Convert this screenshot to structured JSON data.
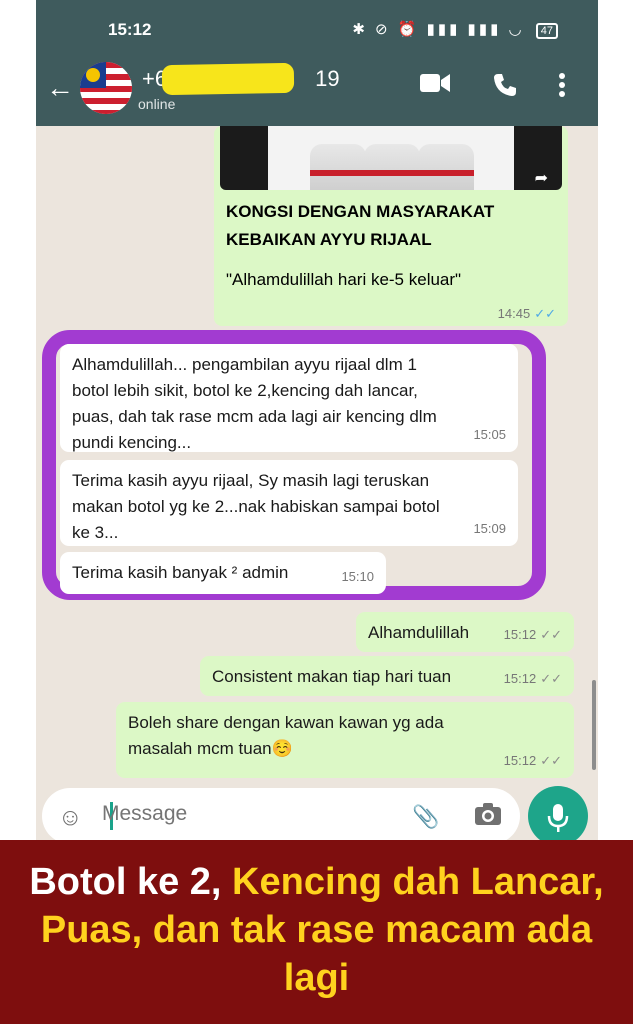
{
  "status": {
    "time": "15:12",
    "icons": "✱ ⊘ ⏰ ▮▮▮ ▮▮▮ ◡",
    "battery": "47"
  },
  "header": {
    "back_icon": "arrow-left-icon",
    "contact_prefix": "+6",
    "contact_suffix": "19",
    "status": "online",
    "video_icon": "video-icon",
    "call_icon": "phone-icon",
    "menu_icon": "more-icon"
  },
  "forwarded": {
    "heading_line1": "KONGSI DENGAN MASYARAKAT",
    "heading_line2": "KEBAIKAN AYYU RIJAAL",
    "quote": "\"Alhamdulillah hari ke-5 keluar\"",
    "time": "14:45"
  },
  "messages": [
    {
      "dir": "in",
      "lines": [
        "Alhamdulillah... pengambilan ayyu rijaal dlm 1",
        "botol lebih sikit, botol ke 2,kencing dah lancar,",
        "puas, dah tak rase mcm ada lagi air kencing dlm",
        "pundi kencing..."
      ],
      "time": "15:05"
    },
    {
      "dir": "in",
      "lines": [
        "Terima kasih ayyu rijaal, Sy masih lagi teruskan",
        "makan botol yg ke 2...nak habiskan sampai botol",
        "ke 3..."
      ],
      "time": "15:09"
    },
    {
      "dir": "in",
      "lines": [
        "Terima kasih banyak ² admin"
      ],
      "time": "15:10"
    },
    {
      "dir": "out",
      "lines": [
        "Alhamdulillah"
      ],
      "time": "15:12"
    },
    {
      "dir": "out",
      "lines": [
        "Consistent makan tiap hari tuan"
      ],
      "time": "15:12"
    },
    {
      "dir": "out",
      "lines": [
        "Boleh share dengan kawan kawan yg ada",
        "masalah mcm tuan☺️"
      ],
      "time": "15:12"
    }
  ],
  "input": {
    "placeholder": "Message",
    "emoji_icon": "emoji-icon",
    "attach_icon": "paperclip-icon",
    "camera_icon": "camera-icon",
    "mic_icon": "mic-icon"
  },
  "banner": {
    "line1_white": "Botol ke 2,",
    "line1_yellow": "Kencing dah Lancar,",
    "line2_yellow": "Puas, dan tak rase macam ada",
    "line3_yellow": "lagi"
  },
  "colors": {
    "header": "#3f5b5d",
    "chat_bg": "#ECE5DD",
    "outgoing": "#dcf8c6",
    "incoming": "#ffffff",
    "highlight": "#a23bd1",
    "banner_bg": "#7e0e0e",
    "banner_yellow": "#ffd21e",
    "mic": "#1ea58a"
  }
}
